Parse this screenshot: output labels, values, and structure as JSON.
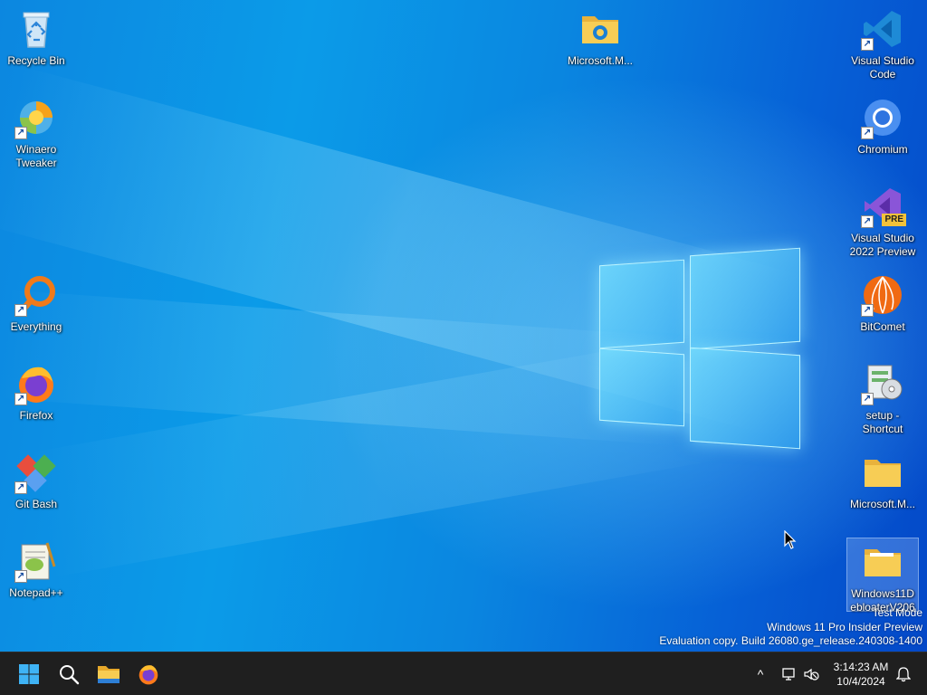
{
  "desktop": {
    "icons": [
      {
        "label": "Recycle Bin",
        "icon": "recycle-bin-icon"
      },
      {
        "label": "Winaero Tweaker",
        "icon": "winaero-tweaker-icon"
      },
      {
        "label": "Everything",
        "icon": "everything-search-icon"
      },
      {
        "label": "Firefox",
        "icon": "firefox-icon"
      },
      {
        "label": "Git Bash",
        "icon": "git-bash-icon"
      },
      {
        "label": "Notepad++",
        "icon": "notepad-plus-plus-icon"
      },
      {
        "label": "Microsoft.M...",
        "icon": "folder-edge-icon"
      },
      {
        "label": "Visual Studio Code",
        "icon": "vscode-icon"
      },
      {
        "label": "Chromium",
        "icon": "chromium-icon"
      },
      {
        "label": "Visual Studio 2022 Preview",
        "icon": "visual-studio-preview-icon",
        "badge": "PRE"
      },
      {
        "label": "BitComet",
        "icon": "bitcomet-icon"
      },
      {
        "label": "setup - Shortcut",
        "icon": "setup-installer-icon"
      },
      {
        "label": "Microsoft.M...",
        "icon": "folder-icon"
      },
      {
        "label": "Windows11DebloaterV206",
        "icon": "folder-icon"
      }
    ]
  },
  "watermark": {
    "line1": "Test Mode",
    "line2": "Windows 11 Pro Insider Preview",
    "line3": "Evaluation copy. Build 26080.ge_release.240308-1400"
  },
  "taskbar": {
    "pinned": [
      {
        "name": "Start",
        "icon": "windows-start-icon"
      },
      {
        "name": "Search",
        "icon": "search-icon"
      },
      {
        "name": "File Explorer",
        "icon": "file-explorer-icon"
      },
      {
        "name": "Firefox",
        "icon": "firefox-icon"
      }
    ],
    "tray": {
      "chevron": "^",
      "time": "3:14:23 AM",
      "date": "10/4/2024"
    }
  },
  "colors": {
    "taskbar_bg": "#1f1f1f",
    "wallpaper_blue": "#0a86e0",
    "folder_yellow": "#f5c84c"
  }
}
